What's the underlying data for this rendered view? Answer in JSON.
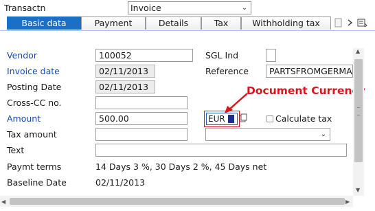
{
  "transaction": {
    "label": "Transactn",
    "value": "Invoice"
  },
  "tabs": [
    {
      "label": "Basic data",
      "active": true
    },
    {
      "label": "Payment",
      "active": false
    },
    {
      "label": "Details",
      "active": false
    },
    {
      "label": "Tax",
      "active": false
    },
    {
      "label": "Withholding tax",
      "active": false
    }
  ],
  "form": {
    "vendor": {
      "label": "Vendor",
      "value": "100052"
    },
    "invoice_date": {
      "label": "Invoice date",
      "value": "02/11/2013"
    },
    "posting_date": {
      "label": "Posting Date",
      "value": "02/11/2013"
    },
    "cross_cc": {
      "label": "Cross-CC no.",
      "value": ""
    },
    "amount": {
      "label": "Amount",
      "value": "500.00"
    },
    "tax_amount": {
      "label": "Tax amount",
      "value": ""
    },
    "text": {
      "label": "Text",
      "value": ""
    },
    "payment_terms": {
      "label": "Paymt terms",
      "value": "14 Days 3 %, 30 Days 2 %, 45 Days net"
    },
    "baseline_date": {
      "label": "Baseline Date",
      "value": "02/11/2013"
    },
    "sgl_ind": {
      "label": "SGL Ind",
      "value": ""
    },
    "reference": {
      "label": "Reference",
      "value": "PARTSFROMGERMANY"
    },
    "currency": {
      "value": "EUR"
    },
    "calculate_tax": {
      "label": "Calculate tax",
      "checked": false
    }
  },
  "annotation": {
    "text": "Document Currency",
    "color": "#d9141c"
  },
  "colors": {
    "accent": "#1b6fc7",
    "label_blue": "#1749b4"
  }
}
